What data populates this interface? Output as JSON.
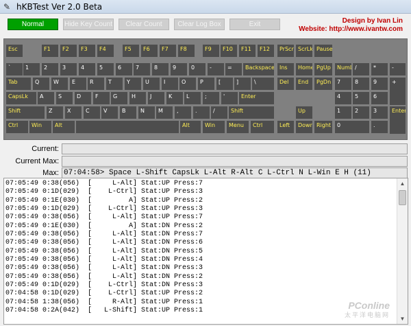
{
  "window": {
    "title": "hKBTest Ver 2.0 Beta"
  },
  "toolbar": {
    "normal": "Normal",
    "hide_key_count": "Hide Key Count",
    "clear_count": "Clear Count",
    "clear_log_box": "Clear Log Box",
    "exit": "Exit",
    "design_by": "Design by Ivan Lin",
    "website": "Website: http://www.ivantw.com"
  },
  "keys": {
    "esc": "Esc",
    "f1": "F1",
    "f2": "F2",
    "f3": "F3",
    "f4": "F4",
    "f5": "F5",
    "f6": "F6",
    "f7": "F7",
    "f8": "F8",
    "f9": "F9",
    "f10": "F10",
    "f11": "F11",
    "f12": "F12",
    "prscr": "PrScr",
    "scrlk": "ScrLk",
    "pause": "Pause",
    "backtick": "`",
    "d1": "1",
    "d2": "2",
    "d3": "3",
    "d4": "4",
    "d5": "5",
    "d6": "6",
    "d7": "7",
    "d8": "8",
    "d9": "9",
    "d0": "0",
    "minus": "-",
    "equals": "=",
    "backspace": "Backspace",
    "ins": "Ins",
    "home": "Home",
    "pgup": "PgUp",
    "numlk": "NumLk",
    "np_div": "/",
    "np_mul": "*",
    "np_sub": "-",
    "tab": "Tab",
    "q": "Q",
    "w": "W",
    "e": "E",
    "r": "R",
    "t": "T",
    "y": "Y",
    "u": "U",
    "i": "I",
    "o": "O",
    "p": "P",
    "lbracket": "[",
    "rbracket": "]",
    "backslash": "\\",
    "del": "Del",
    "end": "End",
    "pgdn": "PgDn",
    "np7": "7",
    "np8": "8",
    "np9": "9",
    "np_add": "+",
    "capslk": "CapsLk",
    "a": "A",
    "s": "S",
    "d": "D",
    "f": "F",
    "g": "G",
    "h": "H",
    "j": "J",
    "k": "K",
    "l": "L",
    "semicolon": ";",
    "quote": "'",
    "enter": "Enter",
    "np4": "4",
    "np5": "5",
    "np6": "6",
    "lshift": "Shift",
    "z": "Z",
    "x": "X",
    "c": "C",
    "v": "V",
    "b": "B",
    "n": "N",
    "m": "M",
    "comma": ",",
    "period": ".",
    "slash": "/",
    "rshift": "Shift",
    "up": "Up",
    "np1": "1",
    "np2": "2",
    "np3": "3",
    "np_enter": "Enter",
    "lctrl": "Ctrl",
    "lwin": "Win",
    "lalt": "Alt",
    "ralt": "Alt",
    "rwin": "Win",
    "menu": "Menu",
    "rctrl": "Ctrl",
    "left": "Left",
    "down": "Down",
    "right": "Right",
    "np0": "0",
    "np_dot": "."
  },
  "fields": {
    "current_label": "Current:",
    "current_value": "",
    "current_max_label": "Current Max:",
    "current_max_value": "",
    "max_label": "Max:",
    "max_value": "07:04:58> Space L-Shift CapsLk L-Alt R-Alt C L-Ctrl N L-Win E H (11)"
  },
  "log": [
    "07:05:49 0:38(056)  [     L-Alt] Stat:UP Press:7",
    "07:05:49 0:1D(029)  [    L-Ctrl] Stat:UP Press:3",
    "07:05:49 0:1E(030)  [         A] Stat:UP Press:2",
    "07:05:49 0:1D(029)  [    L-Ctrl] Stat:UP Press:3",
    "07:05:49 0:38(056)  [     L-Alt] Stat:UP Press:7",
    "07:05:49 0:1E(030)  [         A] Stat:DN Press:2",
    "07:05:49 0:38(056)  [     L-Alt] Stat:DN Press:7",
    "07:05:49 0:38(056)  [     L-Alt] Stat:DN Press:6",
    "07:05:49 0:38(056)  [     L-Alt] Stat:DN Press:5",
    "07:05:49 0:38(056)  [     L-Alt] Stat:DN Press:4",
    "07:05:49 0:38(056)  [     L-Alt] Stat:DN Press:3",
    "07:05:49 0:38(056)  [     L-Alt] Stat:DN Press:2",
    "07:05:49 0:1D(029)  [    L-Ctrl] Stat:DN Press:3",
    "07:04:58 0:1D(029)  [    L-Ctrl] Stat:UP Press:2",
    "07:04:58 1:38(056)  [     R-Alt] Stat:UP Press:1",
    "07:04:58 0:2A(042)  [   L-Shift] Stat:UP Press:1"
  ],
  "watermark": {
    "brand": "PConline",
    "sub": "太平洋电脑网"
  },
  "colors": {
    "active_button": "#00a000",
    "key_label": "#ffee55",
    "designer_text": "#c00000"
  }
}
